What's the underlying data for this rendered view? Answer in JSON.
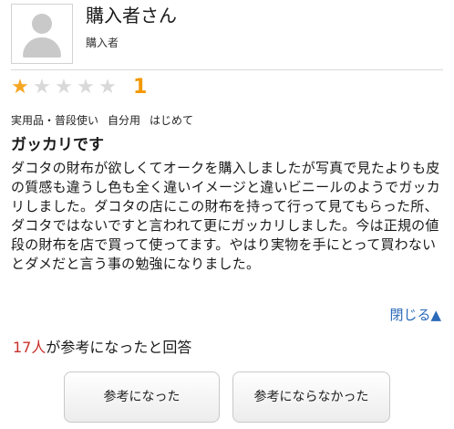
{
  "reviewer": {
    "name": "購入者さん",
    "role": "購入者",
    "avatar_icon": "user-silhouette-icon"
  },
  "rating": {
    "value": 1,
    "max": 5,
    "label": "1",
    "star_color": "#f5a623",
    "empty_star_color": "#d9d9d9"
  },
  "tags": [
    "実用品・普段使い",
    "自分用",
    "はじめて"
  ],
  "review": {
    "title": "ガッカリです",
    "body": "ダコタの財布が欲しくてオークを購入しましたが写真で見たよりも皮の質感も違うし色も全く違いイメージと違いビニールのようでガッカリしました。ダコタの店にこの財布を持って行って見てもらった所、ダコタではないですと言われて更にガッカリしました。今は正規の値段の財布を店で買って使ってます。やはり実物を手にとって買わないとダメだと言う事の勉強になりました。"
  },
  "close_link": "閉じる▲",
  "helpful": {
    "count_text": "17人",
    "suffix": "が参考になったと回答"
  },
  "buttons": {
    "helpful": "参考になった",
    "not_helpful": "参考にならなかった"
  },
  "colors": {
    "accent": "#c9302c",
    "rating_number": "#f39800",
    "link": "#2b6ab8"
  }
}
